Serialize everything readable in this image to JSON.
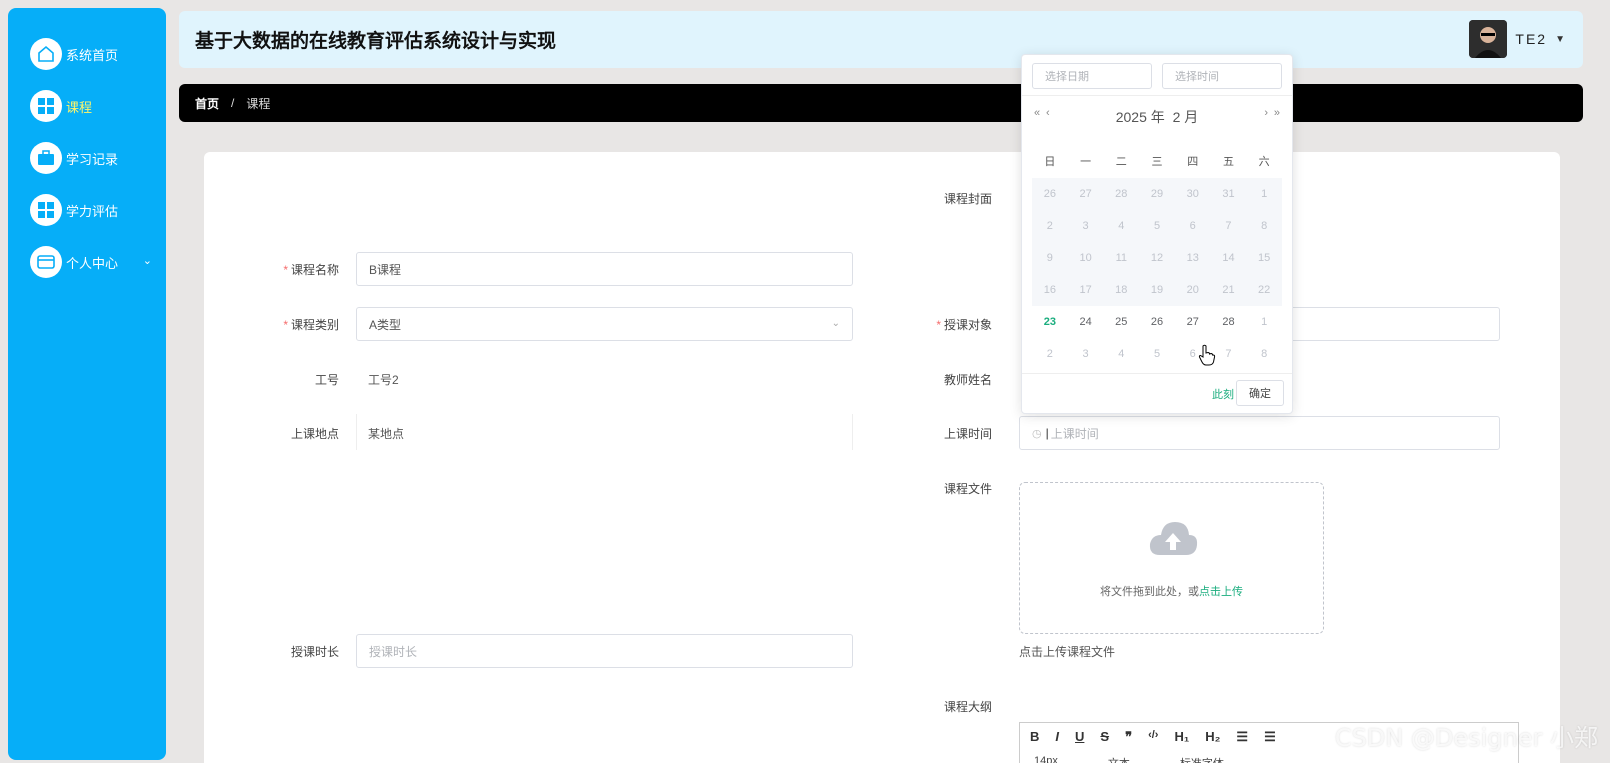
{
  "header": {
    "title": "基于大数据的在线教育评估系统设计与实现",
    "user_name": "TE2"
  },
  "sidebar": {
    "items": [
      {
        "label": "系统首页",
        "icon": "home-icon"
      },
      {
        "label": "课程",
        "icon": "grid-icon"
      },
      {
        "label": "学习记录",
        "icon": "briefcase-icon"
      },
      {
        "label": "学力评估",
        "icon": "grid-icon"
      },
      {
        "label": "个人中心",
        "icon": "card-icon"
      }
    ]
  },
  "breadcrumb": {
    "home": "首页",
    "separator": "/",
    "current": "课程"
  },
  "form": {
    "course_name": {
      "label": "课程名称",
      "value": "B课程"
    },
    "course_type": {
      "label": "课程类别",
      "value": "A类型"
    },
    "account": {
      "label": "工号",
      "value": "工号2"
    },
    "location": {
      "label": "上课地点",
      "value": "某地点"
    },
    "duration": {
      "label": "授课时长",
      "placeholder": "授课时长"
    },
    "cover": {
      "label": "课程封面"
    },
    "audience": {
      "label": "授课对象"
    },
    "teacher": {
      "label": "教师姓名"
    },
    "class_time": {
      "label": "上课时间",
      "placeholder": "上课时间"
    },
    "file": {
      "label": "课程文件",
      "upload_text": "将文件拖到此处，或",
      "upload_link": "点击上传",
      "hint": "点击上传课程文件"
    },
    "syllabus": {
      "label": "课程大纲"
    }
  },
  "editor": {
    "buttons": [
      "B",
      "I",
      "U",
      "S",
      "❞",
      "‹/›",
      "H₁",
      "H₂",
      "☰",
      "☰"
    ],
    "selects": [
      "14px",
      "文本",
      "标准字体"
    ]
  },
  "datepicker": {
    "date_placeholder": "选择日期",
    "time_placeholder": "选择时间",
    "year": "2025 年",
    "month": "2 月",
    "weekdays": [
      "日",
      "一",
      "二",
      "三",
      "四",
      "五",
      "六"
    ],
    "rows": [
      [
        "26",
        "27",
        "28",
        "29",
        "30",
        "31",
        "1"
      ],
      [
        "2",
        "3",
        "4",
        "5",
        "6",
        "7",
        "8"
      ],
      [
        "9",
        "10",
        "11",
        "12",
        "13",
        "14",
        "15"
      ],
      [
        "16",
        "17",
        "18",
        "19",
        "20",
        "21",
        "22"
      ],
      [
        "23",
        "24",
        "25",
        "26",
        "27",
        "28",
        "1"
      ],
      [
        "2",
        "3",
        "4",
        "5",
        "6",
        "7",
        "8"
      ]
    ],
    "now_label": "此刻",
    "ok_label": "确定"
  },
  "watermark": "CSDN @Designer 小郑",
  "colors": {
    "sidebar": "#06aef8",
    "accent": "#1aad7e",
    "required": "#f56c6c"
  }
}
